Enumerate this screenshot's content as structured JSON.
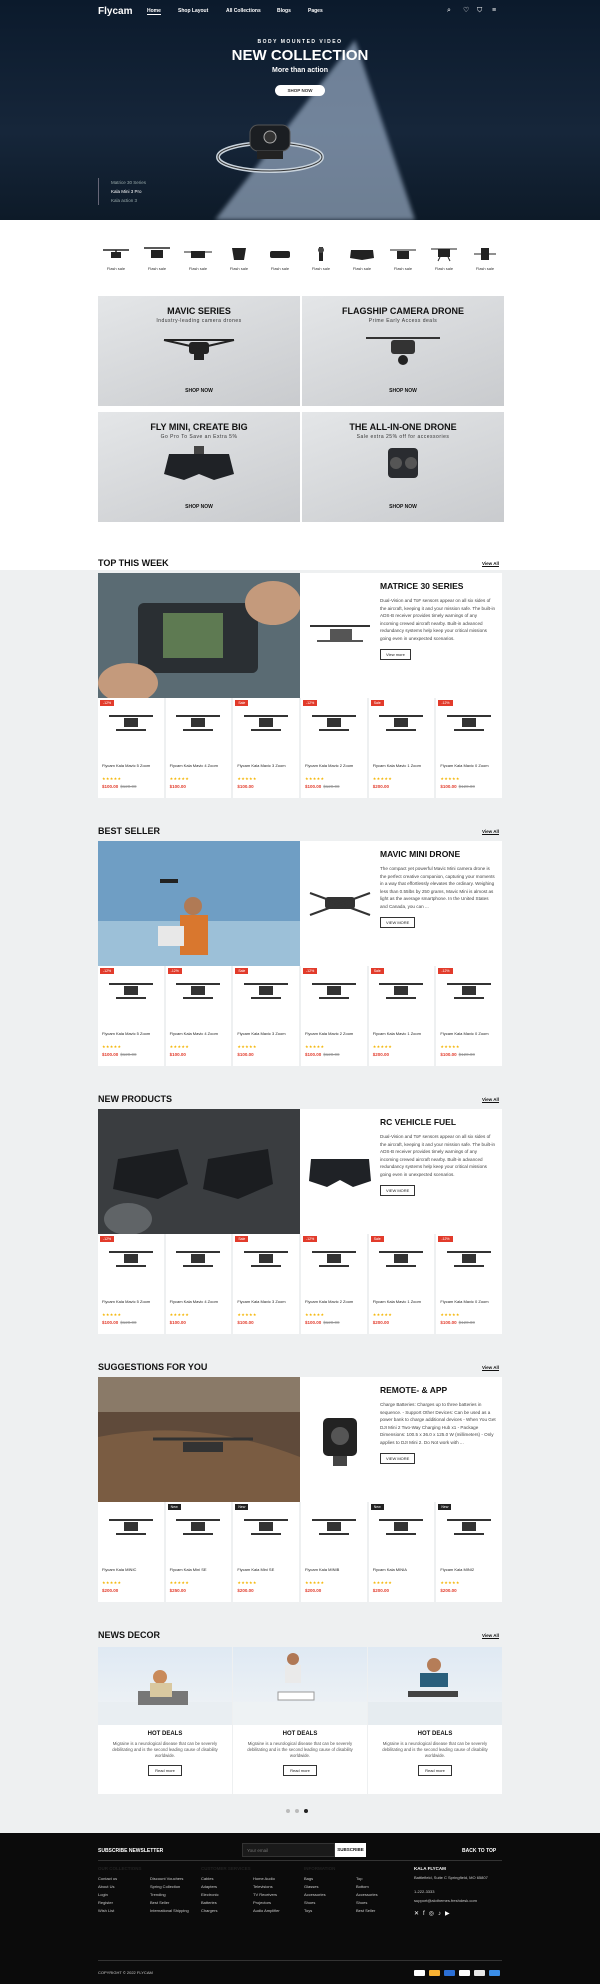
{
  "header": {
    "logo": "Flycam",
    "nav": [
      "Home",
      "Shop Layout",
      "All Collections",
      "Blogs",
      "Pages"
    ]
  },
  "hero": {
    "subtitle": "BODY MOUNTED VIDEO",
    "title": "NEW COLLECTION",
    "tagline": "More than action",
    "button": "SHOP NOW",
    "slides": [
      "Matrice 30 Series",
      "Kala Mini 3 Pro",
      "Kala action 3"
    ]
  },
  "categories": [
    "Flash sale",
    "Flash sale",
    "Flash sale",
    "Flash sale",
    "Flash sale",
    "Flash sale",
    "Flash sale",
    "Flash sale",
    "Flash sale",
    "Flash sale"
  ],
  "promos": [
    {
      "title": "MAVIC SERIES",
      "text": "Industry-leading camera drones",
      "cta": "SHOP NOW"
    },
    {
      "title": "FLAGSHIP CAMERA DRONE",
      "text": "Prime Early Access deals",
      "cta": "SHOP NOW"
    },
    {
      "title": "FLY MINI, CREATE BIG",
      "text": "Go Pro To Save an Extra 5%",
      "cta": "SHOP NOW"
    },
    {
      "title": "THE ALL-IN-ONE DRONE",
      "text": "Sale extra 25% off for accessories",
      "cta": "SHOP NOW"
    }
  ],
  "view_all": "View All",
  "sections": [
    {
      "title": "TOP THIS WEEK",
      "banner": {
        "title": "MATRICE 30 SERIES",
        "text": "Dual-Vision and ToF sensors appear on all six sides of the aircraft, keeping it and your mission safe. The built-in ADS-B receiver provides timely warnings of any incoming crewed aircraft nearby. Built-in advanced redundancy systems help keep your critical missions going even in unexpected scenarios.",
        "button": "View more"
      },
      "products": [
        {
          "badge": "-12%",
          "name": "Flycam Kala Mavic 5 Zoom",
          "price": "$100.00",
          "old": "$120.00"
        },
        {
          "badge": "",
          "name": "Flycam Kala Mavic 4 Zoom",
          "price": "$100.00",
          "old": ""
        },
        {
          "badge": "Sale",
          "name": "Flycam Kala Mavic 3 Zoom",
          "price": "$100.00",
          "old": ""
        },
        {
          "badge": "-12%",
          "name": "Flycam Kala Mavic 2 Zoom",
          "price": "$100.00",
          "old": "$120.00"
        },
        {
          "badge": "Sale",
          "name": "Flycam Kala Mavic 1 Zoom",
          "price": "$200.00",
          "old": ""
        },
        {
          "badge": "-12%",
          "name": "Flycam Kala Mavic 0 Zoom",
          "price": "$100.00",
          "old": "$120.00"
        }
      ]
    },
    {
      "title": "BEST SELLER",
      "banner": {
        "title": "MAVIC MINI DRONE",
        "text": "The compact yet powerful Mavic Mini camera drone is the perfect creative companion, capturing your moments in a way that effortlessly elevates the ordinary. Weighing less than 0.55lbs by 250 grams, Mavic Mini is almost as light as the average smartphone. In the United States and Canada, you can ...",
        "button": "VIEW MORE"
      },
      "products": [
        {
          "badge": "-12%",
          "name": "Flycam Kala Mavic 5 Zoom",
          "price": "$100.00",
          "old": "$120.00"
        },
        {
          "badge": "-12%",
          "name": "Flycam Kala Mavic 4 Zoom",
          "price": "$100.00",
          "old": ""
        },
        {
          "badge": "Sale",
          "name": "Flycam Kala Mavic 3 Zoom",
          "price": "$100.00",
          "old": ""
        },
        {
          "badge": "-12%",
          "name": "Flycam Kala Mavic 2 Zoom",
          "price": "$100.00",
          "old": "$120.00"
        },
        {
          "badge": "Sale",
          "name": "Flycam Kala Mavic 1 Zoom",
          "price": "$200.00",
          "old": ""
        },
        {
          "badge": "-12%",
          "name": "Flycam Kala Mavic 0 Zoom",
          "price": "$100.00",
          "old": "$120.00"
        }
      ]
    },
    {
      "title": "NEW PRODUCTS",
      "banner": {
        "title": "RC VEHICLE FUEL",
        "text": "Dual-Vision and ToF sensors appear on all six sides of the aircraft, keeping it and your mission safe. The built-in ADS-B receiver provides timely warnings of any incoming crewed aircraft nearby. Built-in advanced redundancy systems help keep your critical missions going even in unexpected scenarios.",
        "button": "VIEW MORE"
      },
      "products": [
        {
          "badge": "-12%",
          "name": "Flycam Kala Mavic 5 Zoom",
          "price": "$100.00",
          "old": "$120.00"
        },
        {
          "badge": "",
          "name": "Flycam Kala Mavic 4 Zoom",
          "price": "$100.00",
          "old": ""
        },
        {
          "badge": "Sale",
          "name": "Flycam Kala Mavic 3 Zoom",
          "price": "$100.00",
          "old": ""
        },
        {
          "badge": "-12%",
          "name": "Flycam Kala Mavic 2 Zoom",
          "price": "$100.00",
          "old": "$120.00"
        },
        {
          "badge": "Sale",
          "name": "Flycam Kala Mavic 1 Zoom",
          "price": "$200.00",
          "old": ""
        },
        {
          "badge": "-12%",
          "name": "Flycam Kala Mavic 0 Zoom",
          "price": "$100.00",
          "old": "$120.00"
        }
      ]
    },
    {
      "title": "SUGGESTIONS FOR YOU",
      "banner": {
        "title": "REMOTE- & APP",
        "text": "Charge Batteries: Charges up to three batteries in sequence. - Support Other Devices: Can be used as a power bank to charge additional devices - When You Get DJI Mini 2 Two-Way Charging Hub x1 - Package Dimensions: 100.5 x 36.0 x 125.0 W (millimeters) - Only applies to DJI Mini 2. Do Not work with ...",
        "button": "VIEW MORE"
      },
      "products": [
        {
          "badge": "",
          "name": "Flycam Kala MINIC",
          "price": "$200.00",
          "old": ""
        },
        {
          "badge": "New",
          "name": "Flycam Kala Mini SE",
          "price": "$250.00",
          "old": ""
        },
        {
          "badge": "New",
          "name": "Flycam Kala Mini SE",
          "price": "$200.00",
          "old": ""
        },
        {
          "badge": "",
          "name": "Flycam Kala MINIB",
          "price": "$200.00",
          "old": ""
        },
        {
          "badge": "New",
          "name": "Flycam Kala MINIA",
          "price": "$200.00",
          "old": ""
        },
        {
          "badge": "New",
          "name": "Flycam Kala MINI2",
          "price": "$200.00",
          "old": ""
        }
      ]
    }
  ],
  "news": {
    "title": "NEWS DECOR",
    "items": [
      {
        "title": "HOT DEALS",
        "text": "Migraine is a neurological disease that can be severely debilitating and is the second leading cause of disability worldwide.",
        "button": "Read more"
      },
      {
        "title": "HOT DEALS",
        "text": "Migraine is a neurological disease that can be severely debilitating and is the second leading cause of disability worldwide.",
        "button": "Read more"
      },
      {
        "title": "HOT DEALS",
        "text": "Migraine is a neurological disease that can be severely debilitating and is the second leading cause of disability worldwide.",
        "button": "Read more"
      }
    ]
  },
  "footer": {
    "newsletter": "SUBSCRIBE NEWSLETTER",
    "email_placeholder": "Your email",
    "subscribe": "SUBSCRIBE",
    "back_to_top": "BACK TO TOP",
    "cols": [
      {
        "title": "OUR COLLECTIONS",
        "items": [
          "Contact us",
          "About Us",
          "Login",
          "Register",
          "Wish List"
        ]
      },
      {
        "title": "",
        "items": [
          "Discount Vouchers",
          "Spring Collection",
          "Trending",
          "Best Seller",
          "International Shipping"
        ]
      },
      {
        "title": "CUSTOMER SERVICES",
        "items": [
          "Cables",
          "Adapters",
          "Electronic",
          "Batteries",
          "Chargers"
        ]
      },
      {
        "title": "",
        "items": [
          "Home Audio",
          "Televisions",
          "TV Receivers",
          "Projectors",
          "Audio Amplifier"
        ]
      },
      {
        "title": "INFORMATION",
        "items": [
          "Bags",
          "Glasses",
          "Accessories",
          "Shoes",
          "Toys"
        ]
      },
      {
        "title": "",
        "items": [
          "Top",
          "Bottom",
          "Accessories",
          "Shoes",
          "Best Seller"
        ]
      }
    ],
    "contact": {
      "title": "KALA FLYCAM",
      "address": "Battlefield, Suite C Springfield, MO 65807",
      "phone": "1-222-3333",
      "email": "support@alothemes.freshdesk.com"
    },
    "copyright": "COPYRIGHT © 2022 FLYCAM"
  },
  "colors": {
    "accent": "#e23b2b",
    "dark": "#0b0b0b",
    "hero": "#0b1a2c"
  }
}
